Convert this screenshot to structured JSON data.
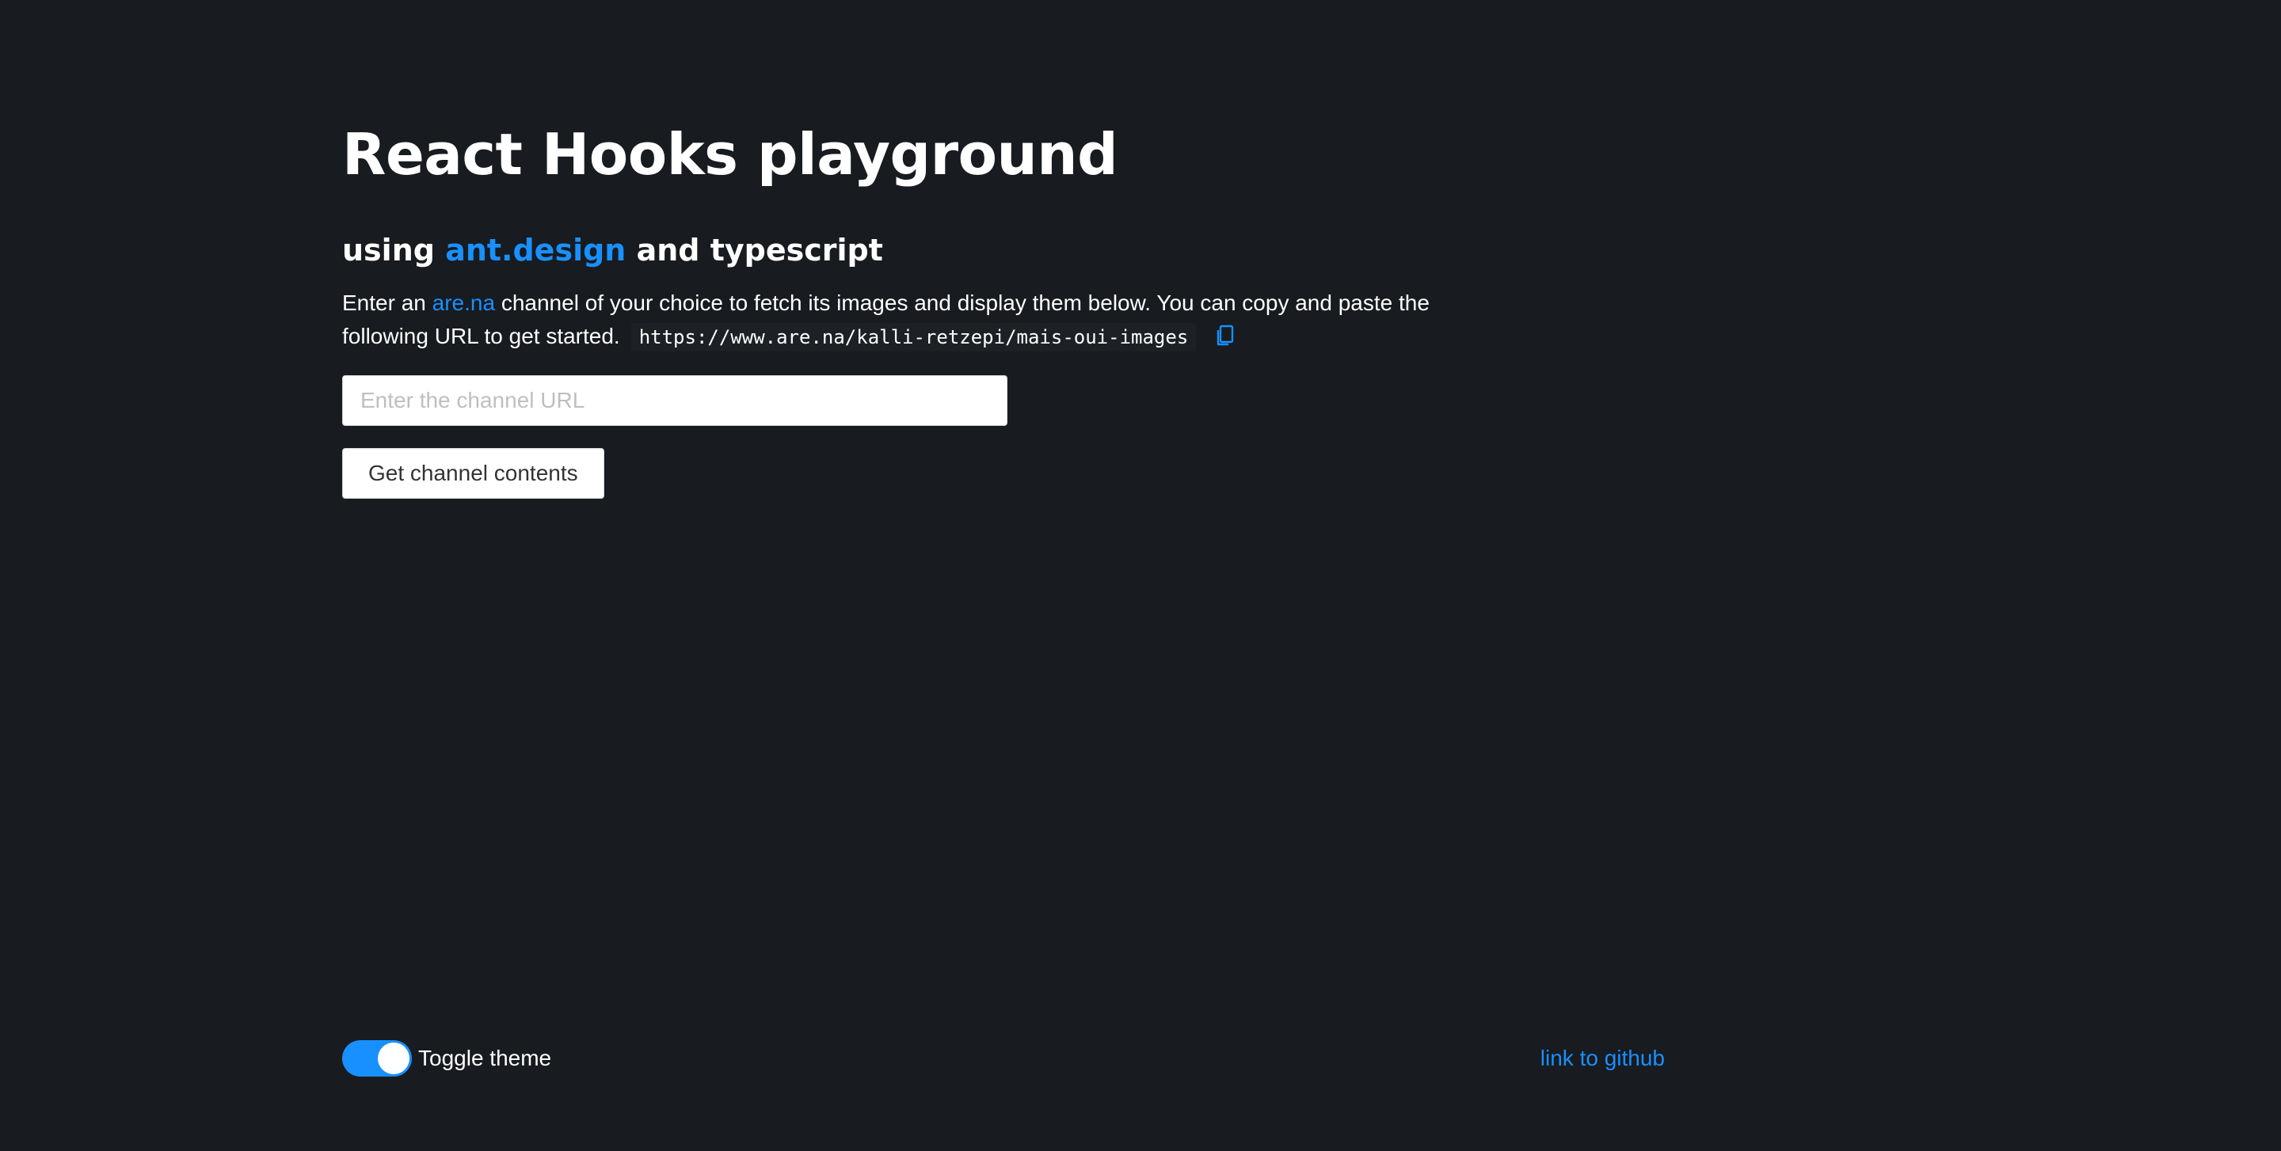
{
  "header": {
    "title": "React Hooks playground",
    "subtitle_prefix": "using ",
    "subtitle_link": "ant.design",
    "subtitle_suffix": " and typescript"
  },
  "intro": {
    "text_before_link": "Enter an ",
    "link_text": "are.na",
    "text_after_link": " channel of your choice to fetch its images and display them below. You can copy and paste the following URL to get started.",
    "example_url": "https://www.are.na/kalli-retzepi/mais-oui-images",
    "copy_icon": "copy-icon"
  },
  "form": {
    "channel_input_value": "",
    "channel_input_placeholder": "Enter the channel URL",
    "submit_label": "Get channel contents"
  },
  "footer": {
    "toggle_label": "Toggle theme",
    "toggle_on": true,
    "github_link": "link to github"
  },
  "colors": {
    "background": "#181b1f",
    "accent": "#1890ff",
    "text": "#ffffff"
  }
}
